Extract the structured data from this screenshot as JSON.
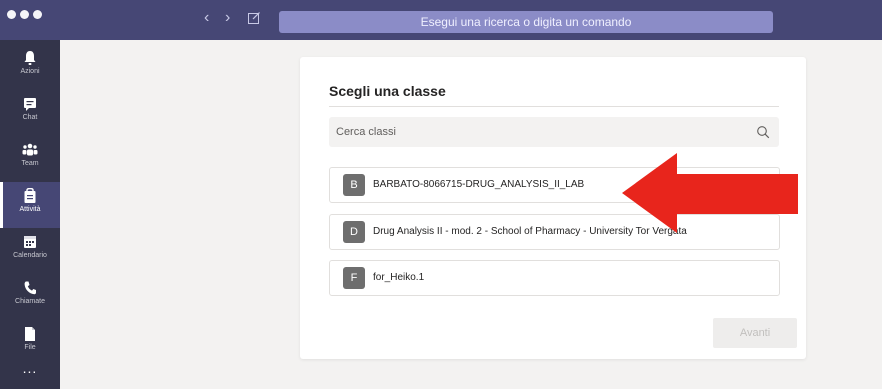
{
  "window": {
    "search_placeholder": "Esegui una ricerca o digita un comando"
  },
  "rail": {
    "items": [
      {
        "label": "Azioni",
        "icon": "bell-icon"
      },
      {
        "label": "Chat",
        "icon": "chat-icon"
      },
      {
        "label": "Team",
        "icon": "team-icon"
      },
      {
        "label": "Attività",
        "icon": "assignments-icon",
        "active": true
      },
      {
        "label": "Calendario",
        "icon": "calendar-icon"
      },
      {
        "label": "Chiamate",
        "icon": "phone-icon"
      },
      {
        "label": "File",
        "icon": "file-icon"
      }
    ],
    "more": "..."
  },
  "dialog": {
    "title": "Scegli una classe",
    "search_placeholder": "Cerca classi",
    "classes": [
      {
        "initial": "B",
        "name": "BARBATO-8066715-DRUG_ANALYSIS_II_LAB"
      },
      {
        "initial": "D",
        "name": "Drug Analysis II - mod. 2 - School of Pharmacy - University Tor Vergata"
      },
      {
        "initial": "F",
        "name": "for_Heiko.1"
      }
    ],
    "next_label": "Avanti"
  },
  "colors": {
    "titlebar": "#464775",
    "rail": "#33344a",
    "accent": "#8b8cc7",
    "annotation_arrow": "#e8251c"
  }
}
